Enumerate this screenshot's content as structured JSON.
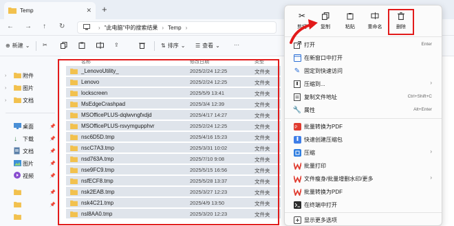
{
  "window": {
    "tab_title": "Temp"
  },
  "address": {
    "crumbs": [
      "\"此电脑\"中的搜索结果",
      "Temp"
    ]
  },
  "commandbar": {
    "new_label": "新建",
    "sort_label": "排序",
    "view_label": "查看"
  },
  "sidebar": {
    "items": [
      {
        "label": "附件",
        "icon": "folder-icon"
      },
      {
        "label": "图片",
        "icon": "folder-icon"
      },
      {
        "label": "文档",
        "icon": "folder-icon"
      },
      {
        "label": "桌面",
        "icon": "desktop-icon"
      },
      {
        "label": "下载",
        "icon": "download-icon"
      },
      {
        "label": "文档",
        "icon": "document-icon"
      },
      {
        "label": "图片",
        "icon": "picture-icon"
      },
      {
        "label": "视频",
        "icon": "video-icon"
      }
    ]
  },
  "list": {
    "headers": {
      "name": "名称",
      "date": "修改日期",
      "type": "类型"
    },
    "files": [
      {
        "name": "_LenovoUtility_",
        "date": "2025/2/24 12:25",
        "type": "文件夹"
      },
      {
        "name": "Lenovo",
        "date": "2025/2/24 12:25",
        "type": "文件夹"
      },
      {
        "name": "lockscreen",
        "date": "2025/5/9 13:41",
        "type": "文件夹"
      },
      {
        "name": "MsEdgeCrashpad",
        "date": "2025/3/4 12:39",
        "type": "文件夹"
      },
      {
        "name": "MSOfficePLUS-dqlwvngfxdjd",
        "date": "2025/4/17 14:27",
        "type": "文件夹"
      },
      {
        "name": "MSOfficePLUS-rsvymgupphvr",
        "date": "2025/2/24 12:25",
        "type": "文件夹"
      },
      {
        "name": "nsc6D5D.tmp",
        "date": "2025/4/16 15:23",
        "type": "文件夹"
      },
      {
        "name": "nscC7A3.tmp",
        "date": "2025/3/31 10:02",
        "type": "文件夹"
      },
      {
        "name": "nsd763A.tmp",
        "date": "2025/7/10 9:08",
        "type": "文件夹"
      },
      {
        "name": "nse9FC9.tmp",
        "date": "2025/5/15 16:56",
        "type": "文件夹"
      },
      {
        "name": "nsfECF8.tmp",
        "date": "2025/5/28 13:37",
        "type": "文件夹"
      },
      {
        "name": "nsk2EAB.tmp",
        "date": "2025/3/27 12:23",
        "type": "文件夹"
      },
      {
        "name": "nsk4C21.tmp",
        "date": "2025/4/9 13:50",
        "type": "文件夹"
      },
      {
        "name": "nsl8AA0.tmp",
        "date": "2025/3/20 12:23",
        "type": "文件夹"
      }
    ]
  },
  "context_menu": {
    "top_buttons": [
      {
        "label": "剪切",
        "icon": "cut-icon"
      },
      {
        "label": "复制",
        "icon": "copy-icon"
      },
      {
        "label": "粘贴",
        "icon": "paste-icon"
      },
      {
        "label": "重命名",
        "icon": "rename-icon"
      },
      {
        "label": "删除",
        "icon": "delete-icon"
      }
    ],
    "items": [
      {
        "label": "打开",
        "shortcut": "Enter"
      },
      {
        "label": "在新窗口中打开",
        "shortcut": ""
      },
      {
        "label": "固定到快速访问",
        "shortcut": ""
      },
      {
        "label": "压缩到...",
        "shortcut": ""
      },
      {
        "label": "复制文件地址",
        "shortcut": "Ctrl+Shift+C"
      },
      {
        "label": "属性",
        "shortcut": "Alt+Enter"
      },
      {
        "label": "批量转换为PDF",
        "shortcut": ""
      },
      {
        "label": "快速创建压缩包",
        "shortcut": ""
      },
      {
        "label": "压缩",
        "shortcut": ""
      },
      {
        "label": "批量打印",
        "shortcut": ""
      },
      {
        "label": "文件瘦身/批量增删水印/更多",
        "shortcut": ""
      },
      {
        "label": "批量转换为PDF",
        "shortcut": ""
      },
      {
        "label": "在终端中打开",
        "shortcut": ""
      },
      {
        "label": "显示更多选项",
        "shortcut": ""
      }
    ]
  },
  "colors": {
    "highlight": "#e21a1a",
    "folder": "#f2c14e",
    "selected_row": "#dfe4eb"
  }
}
